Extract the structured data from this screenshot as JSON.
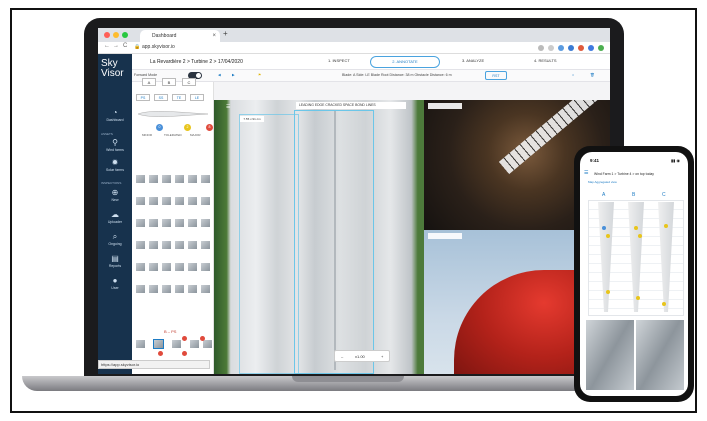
{
  "browser": {
    "tab_title": "Dashboard",
    "tab_close": "×",
    "new_tab": "+",
    "url": "app.skyvisor.io",
    "status_url": "https://app.skyvisor.io",
    "nav_back": "←",
    "nav_forward": "→",
    "nav_reload": "C"
  },
  "app": {
    "logo_line1": "Sky",
    "logo_line2": "Visor",
    "breadcrumb": "La Revardière 2  >  Turbine 2 >  17/04/2020",
    "steps": [
      "1. INSPECT",
      "2. ANNOTATE",
      "3. ANALYZE",
      "4. RESULTS"
    ],
    "forward_mode_label": "Forward Mode",
    "blade_info": "Blade: A   Side: LE   Blade Root Distance: 38 m   Obstacle Distance: 6 m",
    "reset_label": "RST"
  },
  "sidebar": {
    "items": [
      {
        "label": "Dashboard",
        "icon": "dashboard-icon",
        "glyph": "◔"
      },
      {
        "label": "Wind farms",
        "icon": "wind-turbine-icon",
        "glyph": "⚲"
      },
      {
        "label": "Solar farms",
        "icon": "sun-icon",
        "glyph": "✹"
      },
      {
        "label": "New",
        "icon": "plus-circle-icon",
        "glyph": "⊕"
      },
      {
        "label": "Uploader",
        "icon": "cloud-upload-icon",
        "glyph": "☁"
      },
      {
        "label": "Ongoing",
        "icon": "search-icon",
        "glyph": "⌕"
      },
      {
        "label": "Reports",
        "icon": "document-icon",
        "glyph": "▤"
      },
      {
        "label": "User",
        "icon": "user-icon",
        "glyph": "●"
      }
    ],
    "section_assets": "ASSETS",
    "section_inspections": "INSPECTIONS"
  },
  "left_panel": {
    "blades": [
      "A",
      "B",
      "C"
    ],
    "sides": [
      "PS",
      "SS",
      "TE",
      "LE"
    ],
    "badges": [
      {
        "count": "0",
        "label": "MINOR",
        "color": "#4a90d9"
      },
      {
        "count": "2",
        "label": "TOLERATED",
        "color": "#e8c51c"
      },
      {
        "count": "8",
        "label": "MAJOR",
        "color": "#e04a3c"
      }
    ],
    "section_label": "B – PS"
  },
  "viewer": {
    "defect_tag": "LEADING EDGE CRACKED SPACE BOND LINES",
    "size_tooltip": "7.55 x 91 cm",
    "zoom_minus": "–",
    "zoom_value": "x1.00",
    "zoom_plus": "+"
  },
  "phone": {
    "time": "9:41",
    "status": "▮▮ ◉",
    "title": "Wind Farm 1 > Turbine 4 > on top today",
    "tabs": "Map     Aggregated view",
    "cols": [
      "A",
      "B",
      "C"
    ]
  },
  "colors": {
    "sidebar_bg": "#17324d",
    "accent": "#1e7cc4",
    "major": "#e04a3c",
    "tolerated": "#e8c51c",
    "minor": "#4a90d9"
  }
}
